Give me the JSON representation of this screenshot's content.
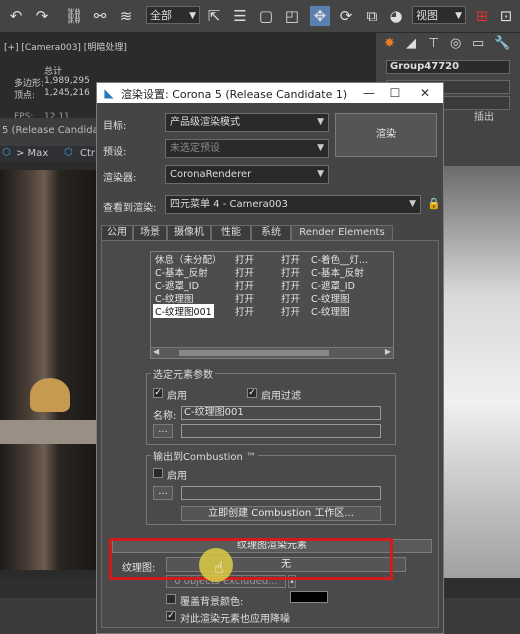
{
  "toolbar": {
    "filter_combo": "全部",
    "view_combo": "视图",
    "icons": [
      "undo-icon",
      "redo-icon",
      "link-icon",
      "unlink-icon",
      "bind-space-warp-icon",
      "select-icon",
      "select-by-name-icon",
      "rect-region-icon",
      "window-crossing-icon",
      "move-icon",
      "rotate-icon",
      "scale-icon",
      "view-combo-icon"
    ]
  },
  "viewport": {
    "label": "[+] [Camera003] [明暗处理]",
    "stats_title": "总计",
    "polys_label": "多边形:",
    "polys_value": "1,989,295",
    "verts_label": "顶点:",
    "verts_value": "1,245,216",
    "fps_label": "FPS:",
    "fps_value": "12.11",
    "tab_label": "5 (Release Candidat",
    "breadcrumb_max": "> Max",
    "breadcrumb_ctr": "Ctr",
    "right_label": "TY"
  },
  "right_panel": {
    "object_name": "Group47720",
    "tab_label": "插出"
  },
  "dialog": {
    "title": "渲染设置: Corona 5 (Release Candidate 1)",
    "target_label": "目标:",
    "target_value": "产品级渲染模式",
    "preset_label": "预设:",
    "preset_value": "未选定预设",
    "renderer_label": "渲染器:",
    "renderer_value": "CoronaRenderer",
    "view_label": "查看到渲染:",
    "view_value": "四元菜单 4 - Camera003",
    "render_button": "渲染",
    "tabs": [
      "公用",
      "场景",
      "摄像机",
      "性能",
      "系统",
      "Render Elements"
    ],
    "elements": [
      {
        "name": "休息（未分配）",
        "enabled": "打开",
        "filter": "打开",
        "type": "C-着色__灯..."
      },
      {
        "name": "C-基本_反射",
        "enabled": "打开",
        "filter": "打开",
        "type": "C-基本_反射"
      },
      {
        "name": "C-遮罩_ID",
        "enabled": "打开",
        "filter": "打开",
        "type": "C-遮罩_ID"
      },
      {
        "name": "C-纹理图",
        "enabled": "打开",
        "filter": "打开",
        "type": "C-纹理图"
      },
      {
        "name": "C-纹理图001",
        "enabled": "打开",
        "filter": "打开",
        "type": "C-纹理图"
      }
    ],
    "selected_params": {
      "title": "选定元素参数",
      "enable_label": "启用",
      "enable_filter_label": "启用过滤",
      "name_label": "名称:",
      "name_value": "C-纹理图001",
      "browse_button": "..."
    },
    "combustion": {
      "title": "输出到Combustion ™",
      "enable_label": "启用",
      "browse_button": "...",
      "create_button": "立即创建 Combustion 工作区..."
    },
    "texmap": {
      "rollout_title": "纹理图渲染元素",
      "texmap_label": "纹理图:",
      "texmap_value": "无",
      "excluded_label": "0 objects excluded...",
      "override_bg_label": "覆盖背景颜色:",
      "denoise_label": "对此渲染元素也应用降噪"
    }
  }
}
